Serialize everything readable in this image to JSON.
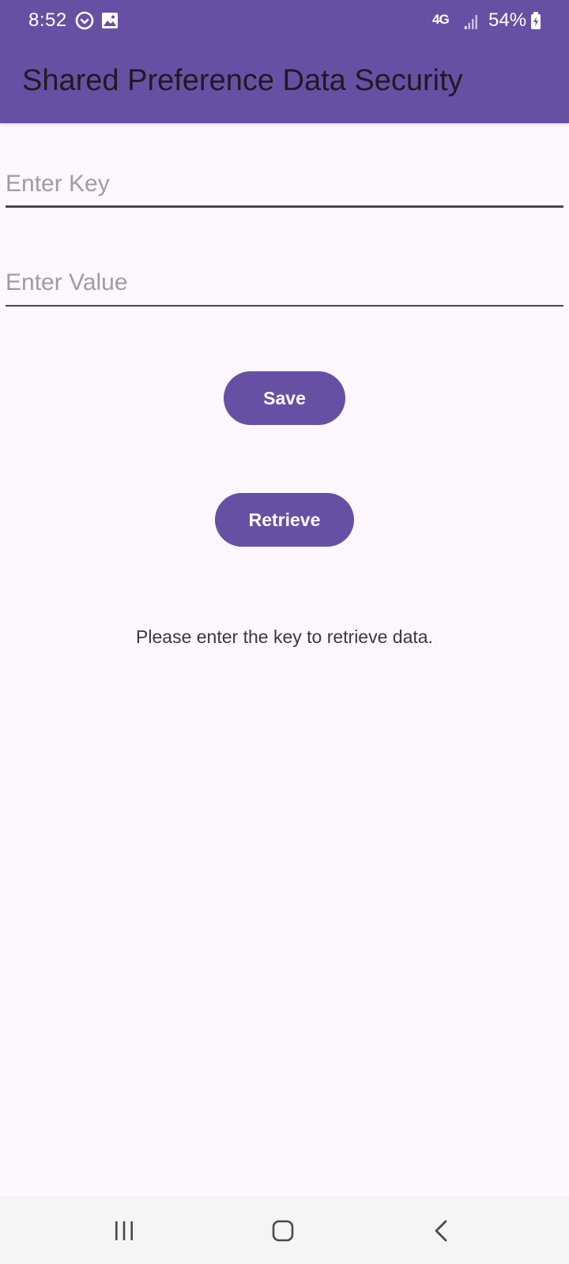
{
  "status_bar": {
    "time": "8:52",
    "network": "4G",
    "battery": "54%",
    "icons": [
      "sync-icon",
      "image-icon",
      "signal-icon",
      "battery-icon"
    ]
  },
  "app_bar": {
    "title": "Shared Preference Data Security"
  },
  "form": {
    "key_field": {
      "placeholder": "Enter Key",
      "value": ""
    },
    "value_field": {
      "placeholder": "Enter Value",
      "value": ""
    }
  },
  "buttons": {
    "save": "Save",
    "retrieve": "Retrieve"
  },
  "message": "Please enter the key to retrieve data.",
  "nav_bar": {
    "icons": [
      "recent-apps-icon",
      "home-icon",
      "back-icon"
    ]
  },
  "colors": {
    "primary": "#6750a4",
    "background": "#fef7fd",
    "on_surface": "#1d1b20",
    "placeholder": "#a09ba3"
  }
}
